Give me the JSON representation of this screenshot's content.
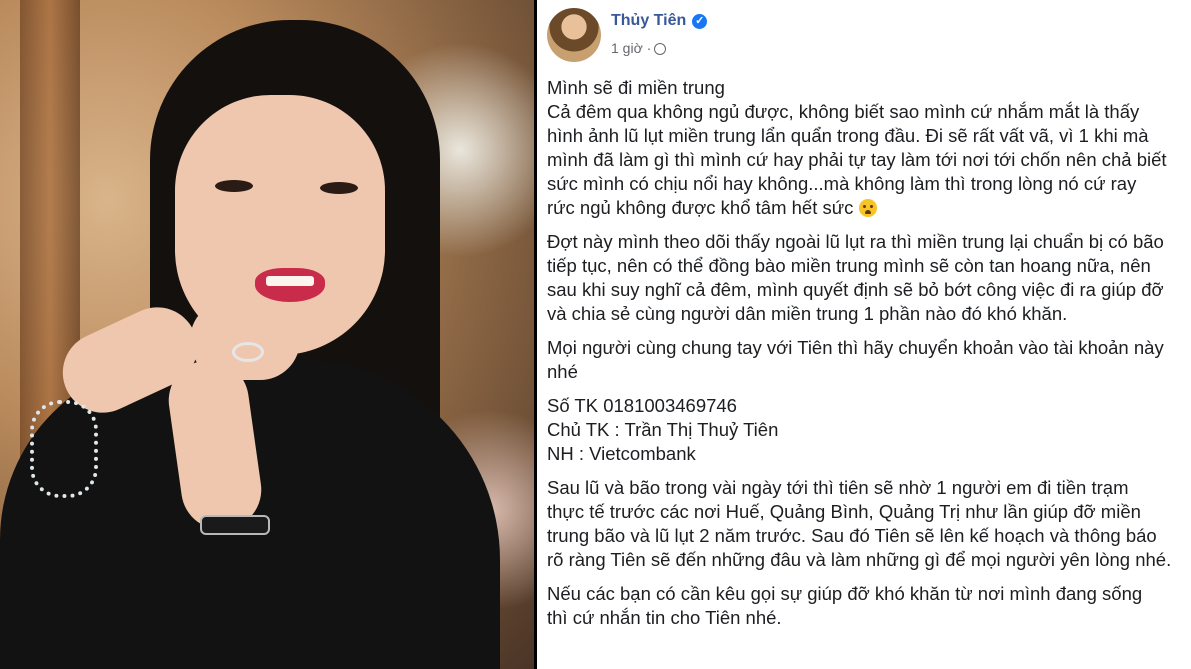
{
  "post": {
    "author": "Thủy Tiên",
    "verified_icon": "verified-badge-icon",
    "time": "1 giờ ·",
    "privacy_icon": "globe-icon",
    "paragraphs": [
      [
        "Mình sẽ đi miền trung",
        "Cả đêm qua không ngủ được, không biết sao mình cứ nhắm mắt là thấy",
        "hình ảnh lũ lụt miền trung lẩn quẩn trong đầu. Đi sẽ rất vất vã, vì 1 khi mà",
        "mình đã làm gì thì mình cứ hay phải tự tay làm tới nơi tới chốn nên chả biết",
        "sức mình có chịu nổi hay không...mà không làm thì trong lòng nó cứ ray",
        "rức ngủ không được khổ tâm hết sức"
      ],
      [
        "Đợt này mình theo dõi thấy ngoài lũ lụt ra thì miền trung lại chuẩn bị có bão",
        "tiếp tục, nên có thể đồng bào miền trung mình sẽ còn tan hoang nữa, nên",
        "sau khi suy nghĩ cả đêm, mình quyết định sẽ bỏ bớt công việc đi ra giúp đỡ",
        "và chia sẻ cùng người dân miền trung 1 phần nào đó khó khăn."
      ],
      [
        "Mọi người cùng chung tay với Tiên thì hãy chuyển khoản vào tài khoản này",
        "nhé"
      ],
      [
        "Số TK 0181003469746",
        "Chủ TK : Trần Thị Thuỷ Tiên",
        "NH : Vietcombank"
      ],
      [
        "Sau lũ và bão trong vài ngày tới thì tiên sẽ nhờ 1 người em đi tiền trạm",
        "thực tế trước các nơi Huế, Quảng Bình, Quảng Trị như lần giúp đỡ miền",
        "trung bão và lũ lụt 2 năm trước. Sau đó Tiên sẽ lên kế hoạch và thông báo",
        "rõ ràng Tiên sẽ đến những đâu và làm những gì để mọi người yên lòng nhé."
      ],
      [
        "Nếu các bạn có cần kêu gọi sự giúp đỡ khó khăn từ nơi mình đang sống",
        "thì cứ nhắn tin cho Tiên nhé."
      ]
    ],
    "emoji_icon": "crying-face-emoji-icon"
  }
}
